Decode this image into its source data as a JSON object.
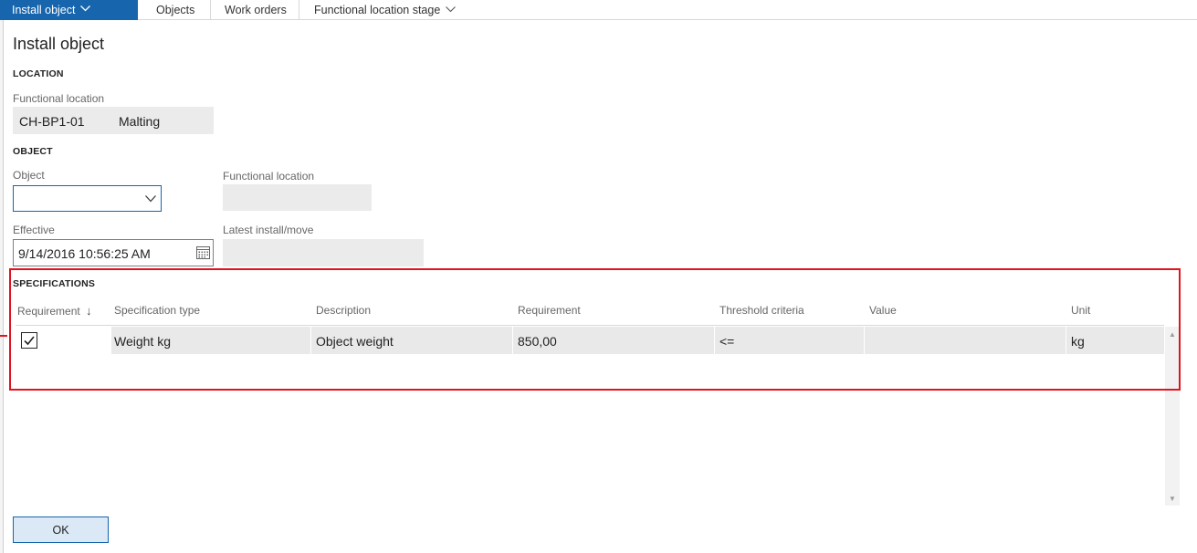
{
  "ribbon": {
    "active_tab": "Install object",
    "tabs": [
      "Objects",
      "Work orders",
      "Functional location stage"
    ]
  },
  "dialog": {
    "title": "Install object",
    "location": {
      "header": "LOCATION",
      "functional_location_label": "Functional location",
      "functional_location_id": "CH-BP1-01",
      "functional_location_name": "Malting"
    },
    "object": {
      "header": "OBJECT",
      "object_label": "Object",
      "object_value": "",
      "functional_location_label": "Functional location",
      "functional_location_value": "",
      "effective_label": "Effective",
      "effective_value": "9/14/2016 10:56:25 AM",
      "latest_install_label": "Latest install/move",
      "latest_install_value": ""
    },
    "specifications": {
      "header": "SPECIFICATIONS",
      "columns": [
        "Requirement",
        "Specification type",
        "Description",
        "Requirement",
        "Threshold criteria",
        "Value",
        "Unit"
      ],
      "sort_indicator": "↓",
      "rows": [
        {
          "requirement_checked": true,
          "specification_type": "Weight kg",
          "description": "Object weight",
          "requirement": "850,00",
          "threshold_criteria": "<=",
          "value": "",
          "unit": "kg"
        }
      ]
    },
    "ok_label": "OK"
  },
  "colors": {
    "accent": "#1765ad",
    "highlight": "#e0141e",
    "readonly_bg": "#ebebeb"
  },
  "icons": [
    "chevron-down-icon",
    "calendar-icon",
    "checkmark-icon",
    "sort-down-icon"
  ]
}
